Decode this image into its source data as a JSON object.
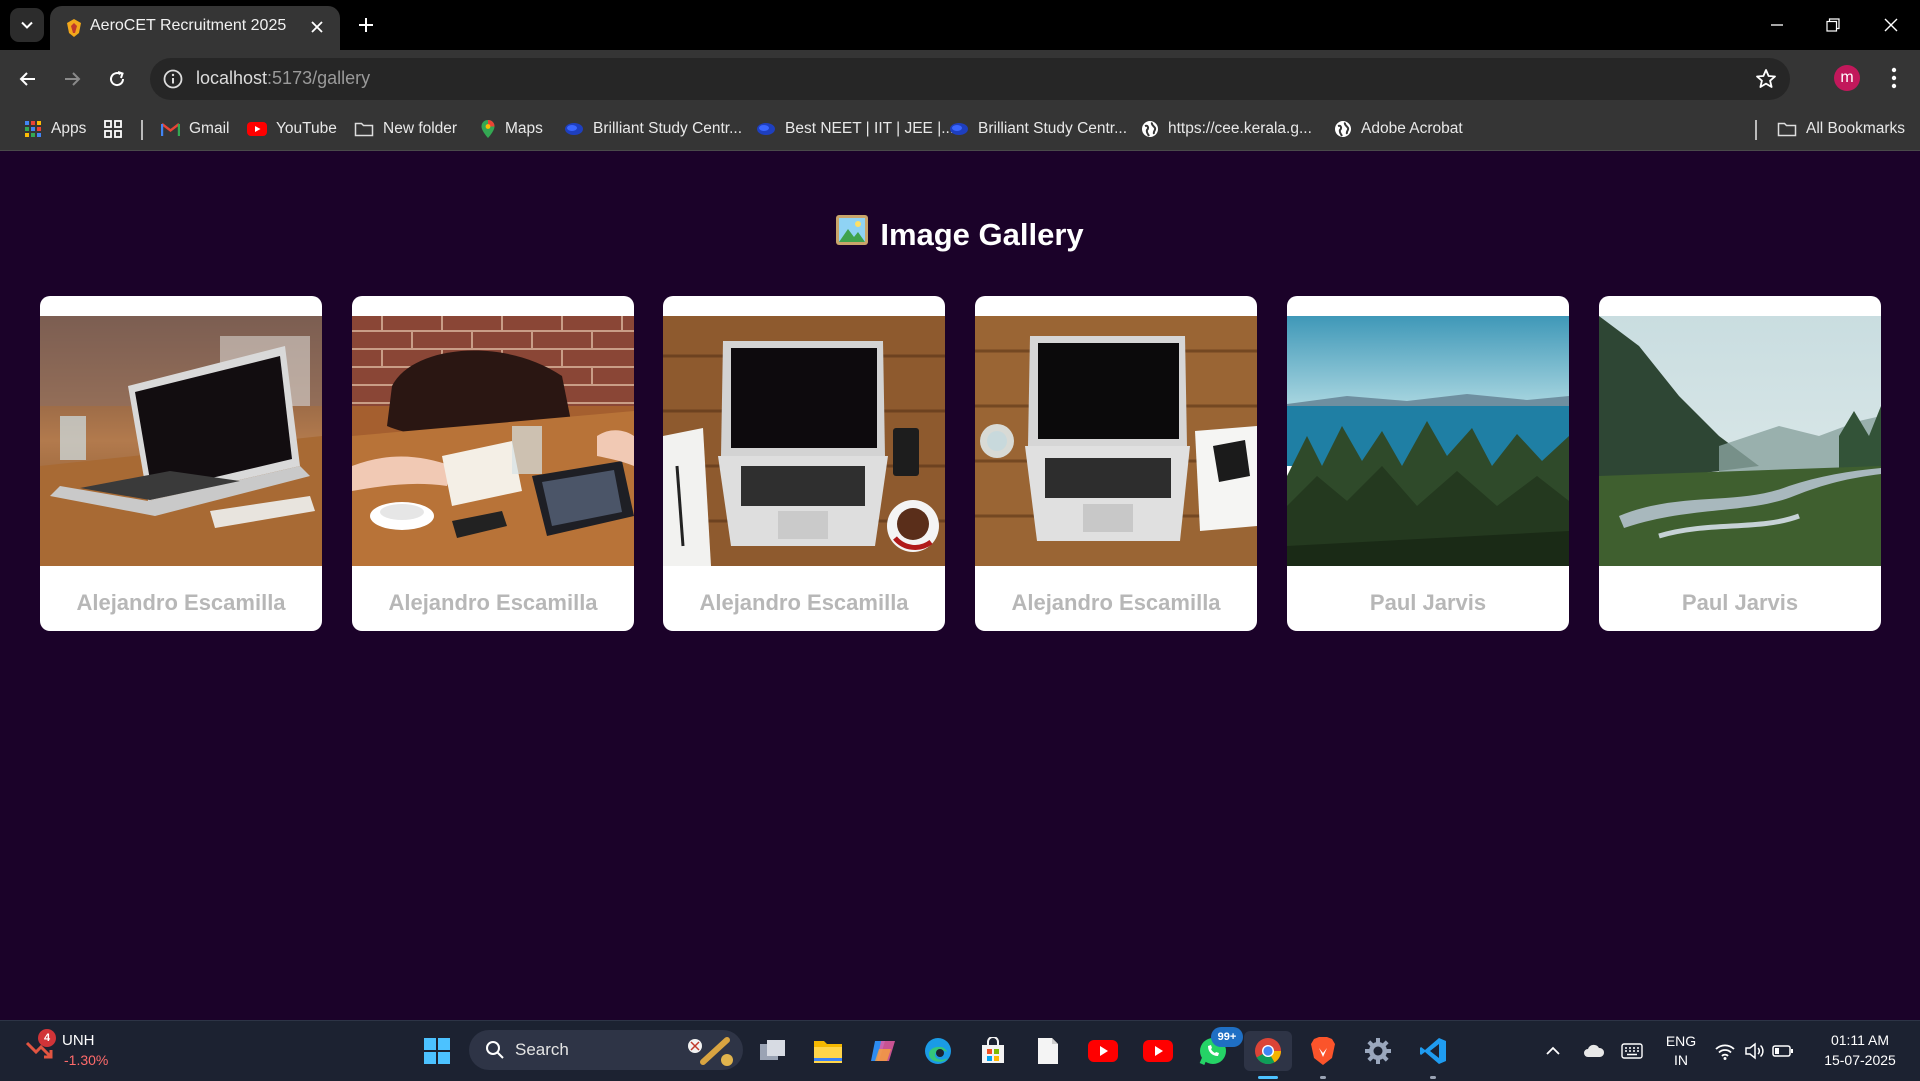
{
  "browser": {
    "tab": {
      "title": "AeroCET Recruitment 2025"
    },
    "address": {
      "host": "localhost",
      "path": ":5173/gallery"
    },
    "profile_initial": "m",
    "bookmarks": [
      {
        "label": "Apps",
        "icon": "apps-grid-icon"
      },
      {
        "label": "Gmail",
        "icon": "gmail-icon"
      },
      {
        "label": "YouTube",
        "icon": "youtube-icon"
      },
      {
        "label": "New folder",
        "icon": "folder-icon"
      },
      {
        "label": "Maps",
        "icon": "maps-icon"
      },
      {
        "label": "Brilliant Study Centr...",
        "icon": "site-icon"
      },
      {
        "label": "Best NEET | IIT | JEE |...",
        "icon": "site-icon"
      },
      {
        "label": "Brilliant Study Centr...",
        "icon": "site-icon"
      },
      {
        "label": "https://cee.kerala.g...",
        "icon": "globe-icon"
      },
      {
        "label": "Adobe Acrobat",
        "icon": "globe-icon"
      }
    ],
    "all_bookmarks": "All Bookmarks"
  },
  "page": {
    "title": "Image Gallery",
    "title_emoji": "🖼️",
    "cards": [
      {
        "author": "Alejandro Escamilla",
        "image": "laptop on wooden table"
      },
      {
        "author": "Alejandro Escamilla",
        "image": "hands writing with bag and tablet"
      },
      {
        "author": "Alejandro Escamilla",
        "image": "laptop top-down with notebook and coffee"
      },
      {
        "author": "Alejandro Escamilla",
        "image": "laptop top-down with glass and phone"
      },
      {
        "author": "Paul Jarvis",
        "image": "lake with forest"
      },
      {
        "author": "Paul Jarvis",
        "image": "river valley with mountains"
      }
    ]
  },
  "taskbar": {
    "stock": {
      "ticker": "UNH",
      "change": "-1.30%",
      "badge": "4"
    },
    "search_label": "Search",
    "whatsapp_badge": "99+",
    "lang": {
      "line1": "ENG",
      "line2": "IN"
    },
    "time": "01:11 AM",
    "date": "15-07-2025"
  },
  "colors": {
    "page_bg": "#1b0229",
    "card_bg": "#ffffff",
    "author_text": "#b7b7b7",
    "stock_negative": "#ff6b6b"
  }
}
